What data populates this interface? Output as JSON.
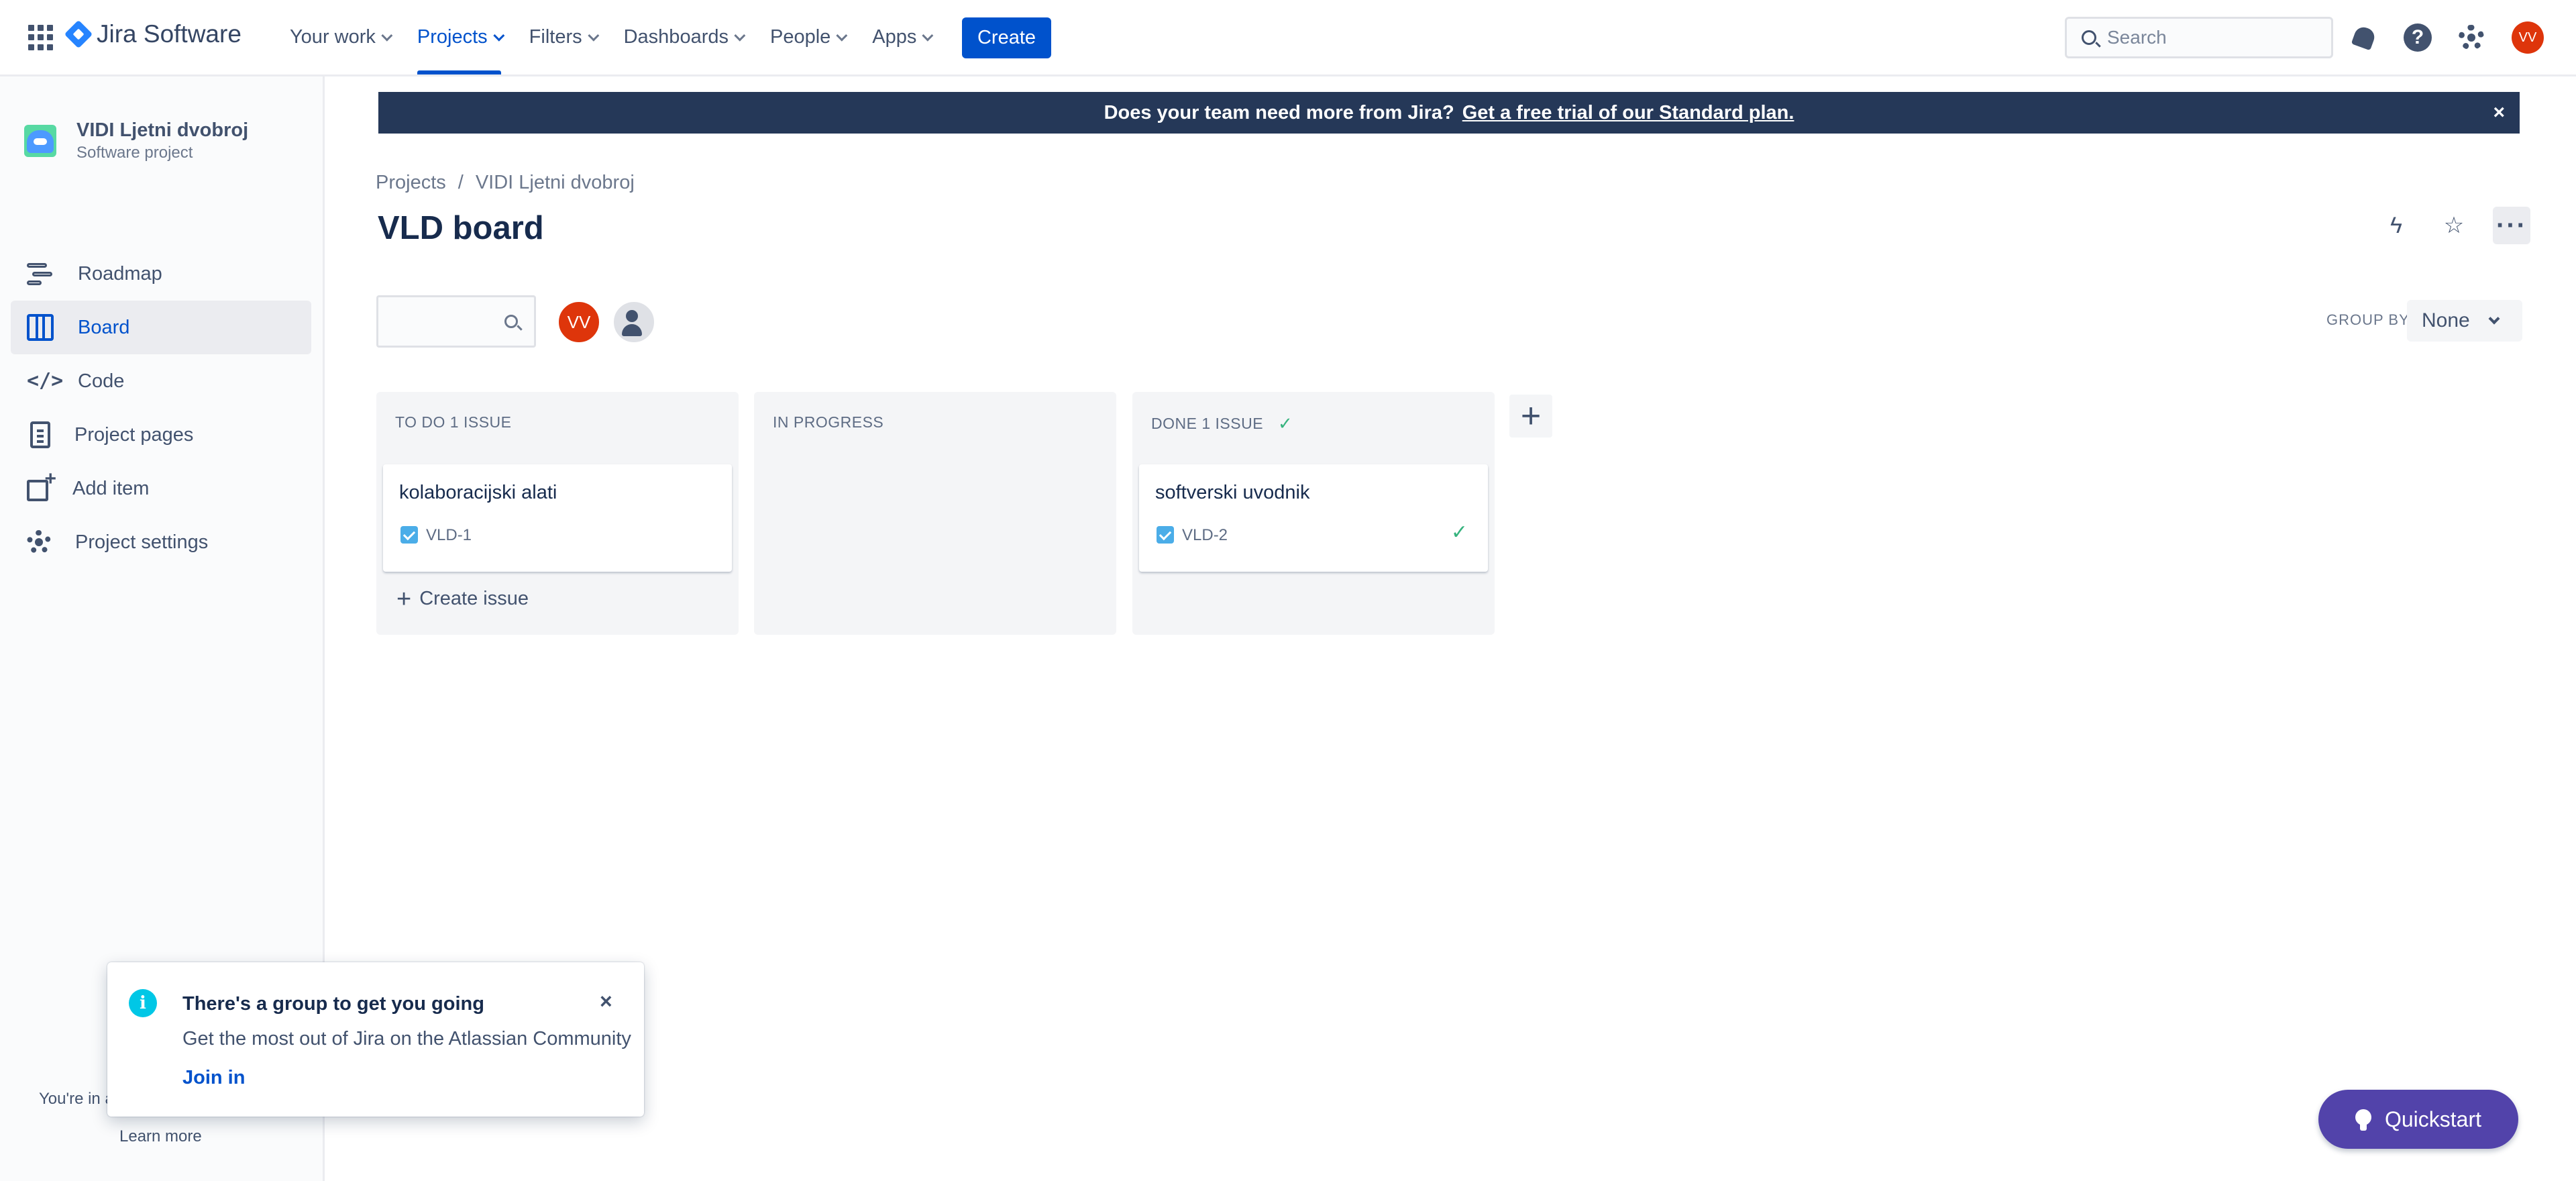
{
  "topnav": {
    "app_switcher_icon": "grid-icon",
    "logo_text": "Jira Software",
    "items": [
      {
        "label": "Your work",
        "active": false
      },
      {
        "label": "Projects",
        "active": true
      },
      {
        "label": "Filters",
        "active": false
      },
      {
        "label": "Dashboards",
        "active": false
      },
      {
        "label": "People",
        "active": false
      },
      {
        "label": "Apps",
        "active": false
      }
    ],
    "create_label": "Create",
    "search_placeholder": "Search",
    "user_initials": "VV"
  },
  "sidebar": {
    "project_name": "VIDI Ljetni dvobroj",
    "project_type": "Software project",
    "items": [
      {
        "label": "Roadmap",
        "icon": "roadmap-icon",
        "active": false
      },
      {
        "label": "Board",
        "icon": "board-icon",
        "active": true
      },
      {
        "label": "Code",
        "icon": "code-icon",
        "active": false
      },
      {
        "label": "Project pages",
        "icon": "pages-icon",
        "active": false
      },
      {
        "label": "Add item",
        "icon": "add-item-icon",
        "active": false
      },
      {
        "label": "Project settings",
        "icon": "settings-icon",
        "active": false
      }
    ],
    "footer_text": "You're in a",
    "footer_link": "Learn more"
  },
  "banner": {
    "text": "Does your team need more from Jira?",
    "link": "Get a free trial of our Standard plan.",
    "close": "×"
  },
  "main": {
    "breadcrumb": [
      "Projects",
      "/",
      "VIDI Ljetni dvobroj"
    ],
    "title": "VLD board",
    "assignee_initials": "VV",
    "group_by_label": "GROUP BY",
    "group_by_value": "None",
    "add_column": "+",
    "columns": [
      {
        "header": "TO DO 1 ISSUE",
        "done_check": false,
        "cards": [
          {
            "title": "kolaboracijski alati",
            "key": "VLD-1",
            "done": false
          }
        ],
        "create_issue": "Create issue"
      },
      {
        "header": "IN PROGRESS",
        "done_check": false,
        "cards": []
      },
      {
        "header": "DONE 1 ISSUE",
        "done_check": true,
        "cards": [
          {
            "title": "softverski uvodnik",
            "key": "VLD-2",
            "done": true
          }
        ]
      }
    ]
  },
  "toast": {
    "title": "There's a group to get you going",
    "body": "Get the most out of Jira on the Atlassian Community",
    "link": "Join in",
    "close": "×",
    "icon": "info-icon"
  },
  "quickstart": {
    "label": "Quickstart",
    "icon": "lightbulb-icon"
  },
  "colors": {
    "brand_blue": "#0052cc",
    "banner_bg": "#253858",
    "avatar_red": "#de350b",
    "quickstart_purple": "#5243aa",
    "done_green": "#36b37e"
  }
}
